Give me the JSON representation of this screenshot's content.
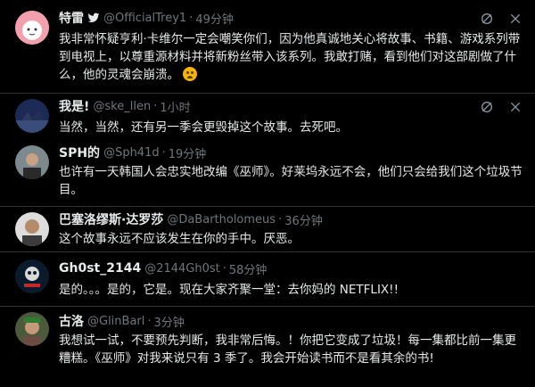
{
  "tweets": [
    {
      "name": "特雷",
      "verified": true,
      "handle": "@OfficialTrey1",
      "time": "49分钟",
      "body": "我非常怀疑亨利·卡维尔一定会嘲笑你们，因为他真诚地关心将故事、书籍、游戏系列带到电视上，以尊重源材料并将新粉丝带入该系列。我敢打赌，看到他们对这部剧做了什么，他的灵魂会崩溃。"
    },
    {
      "name": "我是!",
      "handle": "@ske_llen",
      "time": "1小时",
      "body": "当然，当然，还有另一季会更毁掉这个故事。去死吧。"
    },
    {
      "name": "SPH的",
      "handle": "@Sph41d",
      "time": "19分钟",
      "body": "也许有一天韩国人会忠实地改编《巫师》。好莱坞永远不会，他们只会给我们这个垃圾节目。"
    },
    {
      "name": "巴塞洛缪斯·达罗莎",
      "handle": "@DaBartholomeus",
      "time": "36分钟",
      "body": "这个故事永远不应该发生在你的手中。厌恶。"
    },
    {
      "name": "Gh0st_2144",
      "handle": "@2144Gh0st",
      "time": "58分钟",
      "body": "是的。。。是的，它是。现在大家齐聚一堂：去你妈的 NETFLIX!!"
    },
    {
      "name": "古洛",
      "handle": "@GlinBarl",
      "time": "3分钟",
      "body": "我想试一试，不要预先判断，我非常后悔。！你把它变成了垃圾！每一集都比前一集更糟糕。《巫师》对我来说只有 3 季了。我会开始读书而不是看其余的书!"
    }
  ],
  "icons": {
    "mute": "mute-icon",
    "close": "close-icon",
    "verified": "verified-icon",
    "emoji": "weary-face-emoji"
  },
  "colors": {
    "background": "#000000",
    "text": "#e7e9ea",
    "secondary": "#71767b",
    "border": "#2f3336"
  }
}
